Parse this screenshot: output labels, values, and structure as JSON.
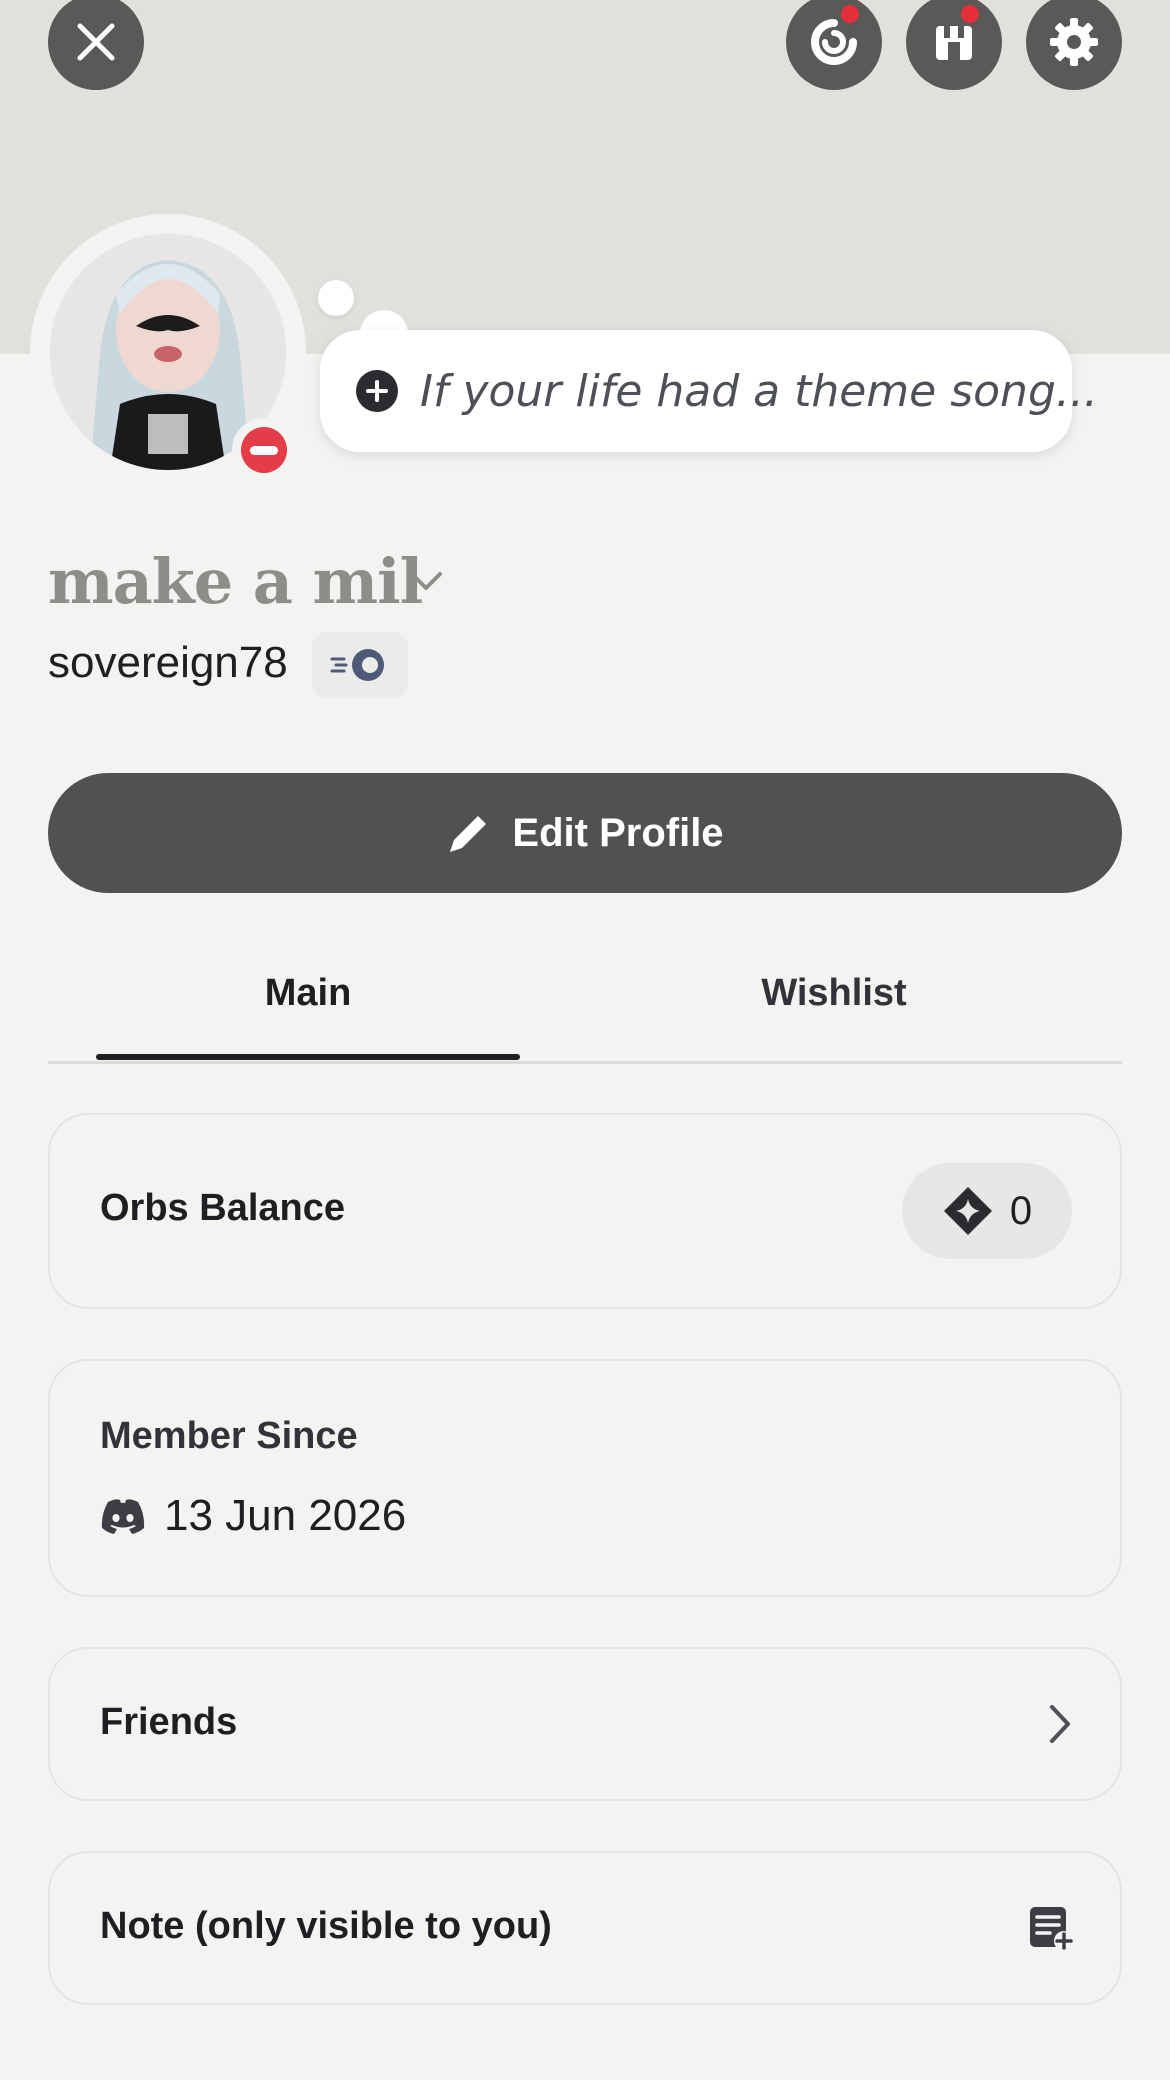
{
  "header": {
    "close_icon": "close-icon",
    "quests_icon": "quests-icon",
    "shop_icon": "shop-icon",
    "settings_icon": "gear-icon"
  },
  "profile": {
    "custom_status_placeholder": "If your life had a theme song...",
    "display_name": "make a mil",
    "username": "sovereign78",
    "status": "do-not-disturb"
  },
  "actions": {
    "edit_profile_label": "Edit Profile"
  },
  "tabs": [
    {
      "label": "Main",
      "active": true
    },
    {
      "label": "Wishlist",
      "active": false
    }
  ],
  "cards": {
    "orbs": {
      "label": "Orbs Balance",
      "value": "0"
    },
    "member_since": {
      "label": "Member Since",
      "date": "13 Jun 2026"
    },
    "friends": {
      "label": "Friends"
    },
    "note": {
      "label": "Note (only visible to you)"
    }
  },
  "colors": {
    "banner": "#e1e0dd",
    "button_dark": "#52514f",
    "dnd_red": "#e23d48",
    "notif_red": "#e5303a"
  }
}
